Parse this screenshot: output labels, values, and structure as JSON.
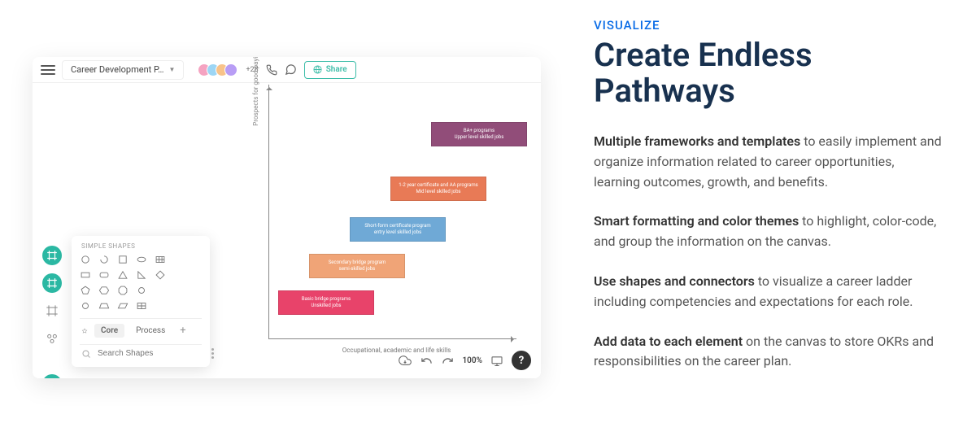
{
  "marketing": {
    "eyebrow": "VISUALIZE",
    "headline": "Create Endless Pathways",
    "paragraphs": [
      {
        "bold": "Multiple frameworks and templates",
        "rest": " to easily implement and organize information related to career opportunities, learning outcomes, growth, and benefits."
      },
      {
        "bold": "Smart formatting and color themes",
        "rest": " to highlight, color-code, and group the information on the canvas."
      },
      {
        "bold": "Use shapes and connectors",
        "rest": " to visualize a career ladder including competencies and expectations for each role."
      },
      {
        "bold": "Add data to each element",
        "rest": " on the canvas to store OKRs and responsibilities on the career plan."
      }
    ]
  },
  "topbar": {
    "docName": "Career Development P…",
    "extraCollab": "+28",
    "shareLabel": "Share"
  },
  "canvas": {
    "yLabel": "Prospects   for   good-paying,    stable   employment",
    "xLabel": "Occupational,    academic    and    life   skills",
    "blocks": {
      "b1": {
        "l1": "Basic   bridge   programs",
        "l2": "Unskilled   jobs"
      },
      "b2": {
        "l1": "Secondary   bridge   program",
        "l2": "semi-skilled   jobs"
      },
      "b3": {
        "l1": "Short-form   certificate   program",
        "l2": "entry   level   skilled   jobs"
      },
      "b4": {
        "l1": "1-2   year   certificate   and   AA programs",
        "l2": "Mid   level   skilled   jobs"
      },
      "b5": {
        "l1": "BA+   programs",
        "l2": "Upper   level   skilled   jobs"
      }
    }
  },
  "shapePanel": {
    "header": "SIMPLE SHAPES",
    "tabs": {
      "core": "Core",
      "process": "Process"
    },
    "searchPlaceholder": "Search Shapes"
  },
  "bottombar": {
    "zoom": "100%"
  }
}
